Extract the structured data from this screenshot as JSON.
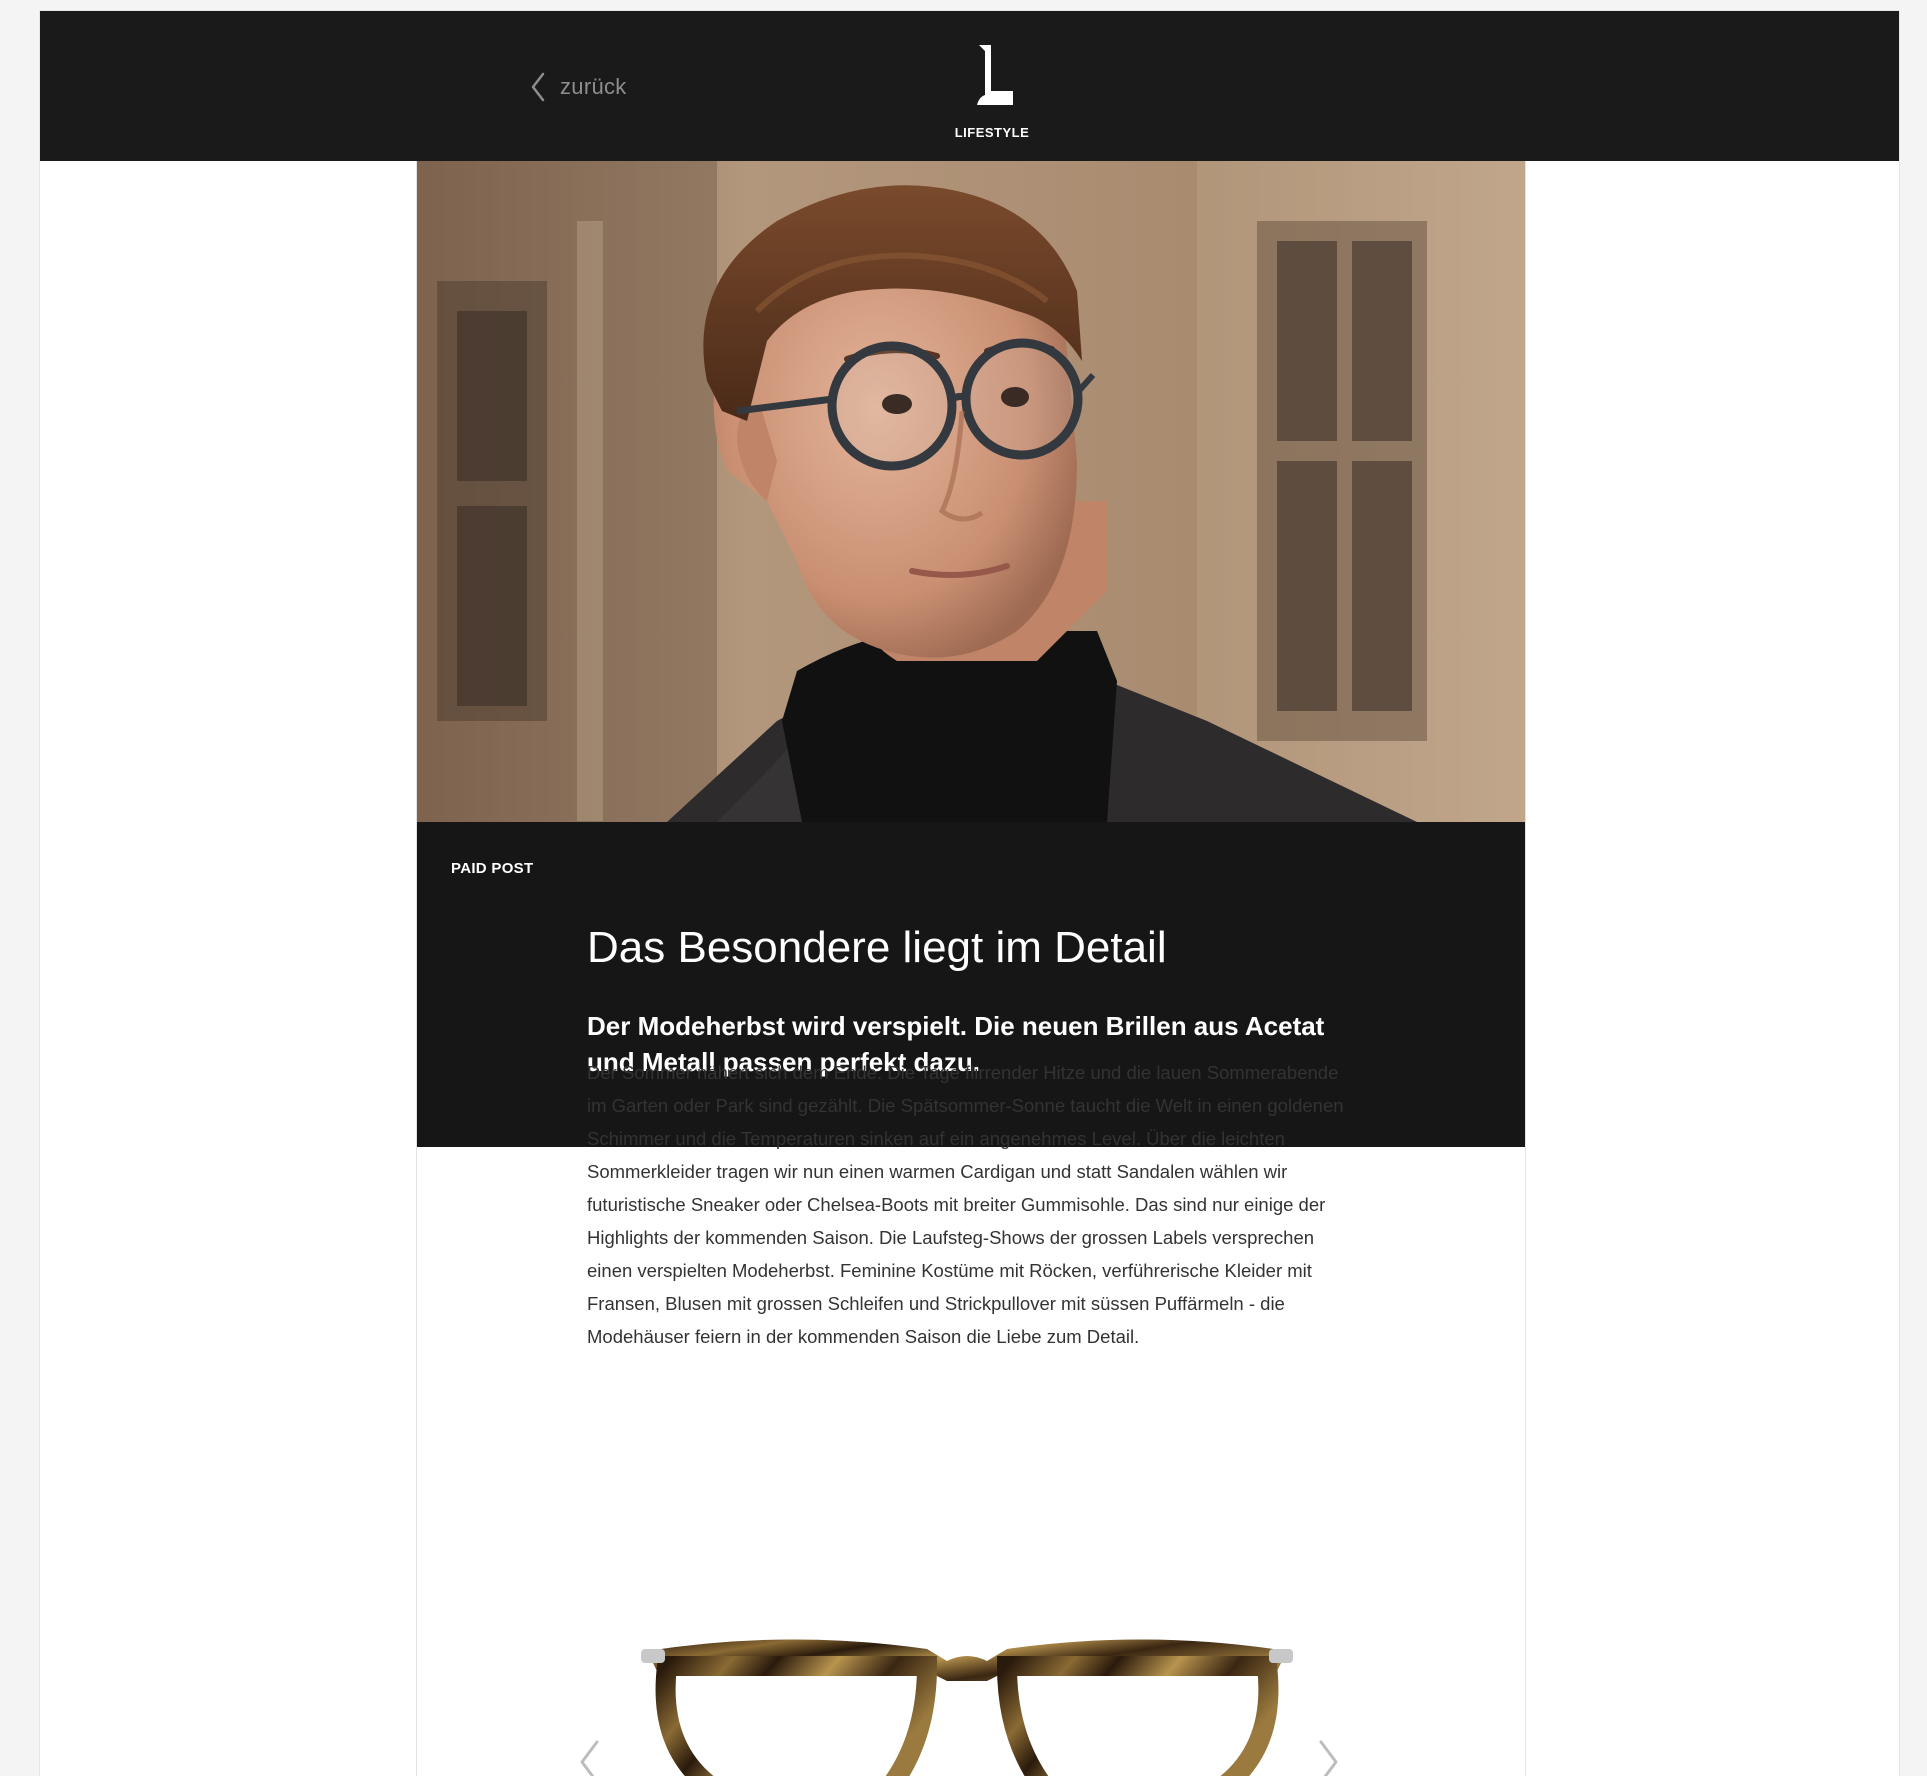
{
  "header": {
    "back_label": "zurück",
    "logo_text": "LIFESTYLE",
    "back_icon": "chevron-left-icon",
    "logo_icon": "l-logo-icon"
  },
  "article": {
    "hero_image": "man-with-round-glasses-photo",
    "badge": "PAID POST",
    "title": "Das Besondere liegt im Detail",
    "subtitle": "Der Modeherbst wird verspielt. Die neuen Brillen aus Acetat und Metall passen perfekt  dazu.",
    "body": "Der Sommer nähert sich dem Ende. Die Tage flirrender Hitze und die lauen Sommerabende im Garten oder Park sind gezählt. Die Spätsommer-Sonne taucht die Welt in einen goldenen Schimmer und die Temperaturen sinken auf ein angenehmes Level. Über die leichten Sommerkleider tragen wir nun einen warmen Cardigan und statt Sandalen wählen wir futuristische Sneaker oder Chelsea-Boots mit breiter Gummisohle. Das sind nur einige der Highlights der kommenden Saison. Die Laufsteg-Shows der grossen Labels versprechen einen verspielten Modeherbst. Feminine Kostüme mit Röcken, verführerische Kleider mit Fransen, Blusen mit grossen Schleifen und Strickpullover mit süssen Puffärmeln - die Modehäuser feiern in der kommenden Saison die Liebe zum Detail."
  },
  "carousel": {
    "image": "tortoiseshell-glasses-photo",
    "prev_icon": "chevron-left-icon",
    "next_icon": "chevron-right-icon"
  },
  "colors": {
    "header_bg": "#1a1a1a",
    "headline_bg": "#161616",
    "text": "#333333",
    "muted": "#8d8d8d"
  }
}
